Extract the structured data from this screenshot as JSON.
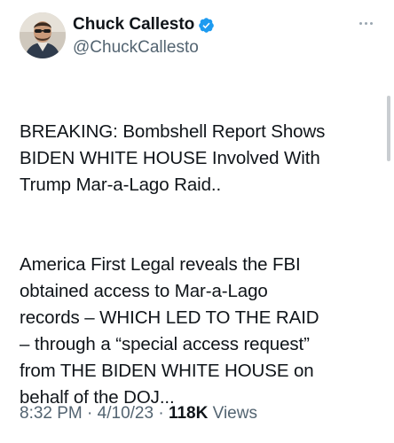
{
  "author": {
    "display_name": "Chuck Callesto",
    "handle": "@ChuckCallesto",
    "verified": true,
    "verified_color": "#1d9bf0",
    "avatar_icon": "profile-photo"
  },
  "tweet": {
    "paragraph_1": "BREAKING: Bombshell Report Shows\nBIDEN WHITE HOUSE Involved With\nTrump Mar-a-Lago Raid..",
    "paragraph_2": "America First Legal reveals the FBI\nobtained access to Mar-a-Lago\nrecords – WHICH LED TO THE RAID\n– through a “special access request”\nfrom THE BIDEN WHITE HOUSE on\nbehalf of the DOJ..."
  },
  "meta": {
    "time": "8:32 PM",
    "separator": "·",
    "date": "4/10/23",
    "views_count": "118K",
    "views_label": "Views"
  },
  "colors": {
    "text": "#0f1419",
    "secondary": "#536471"
  }
}
